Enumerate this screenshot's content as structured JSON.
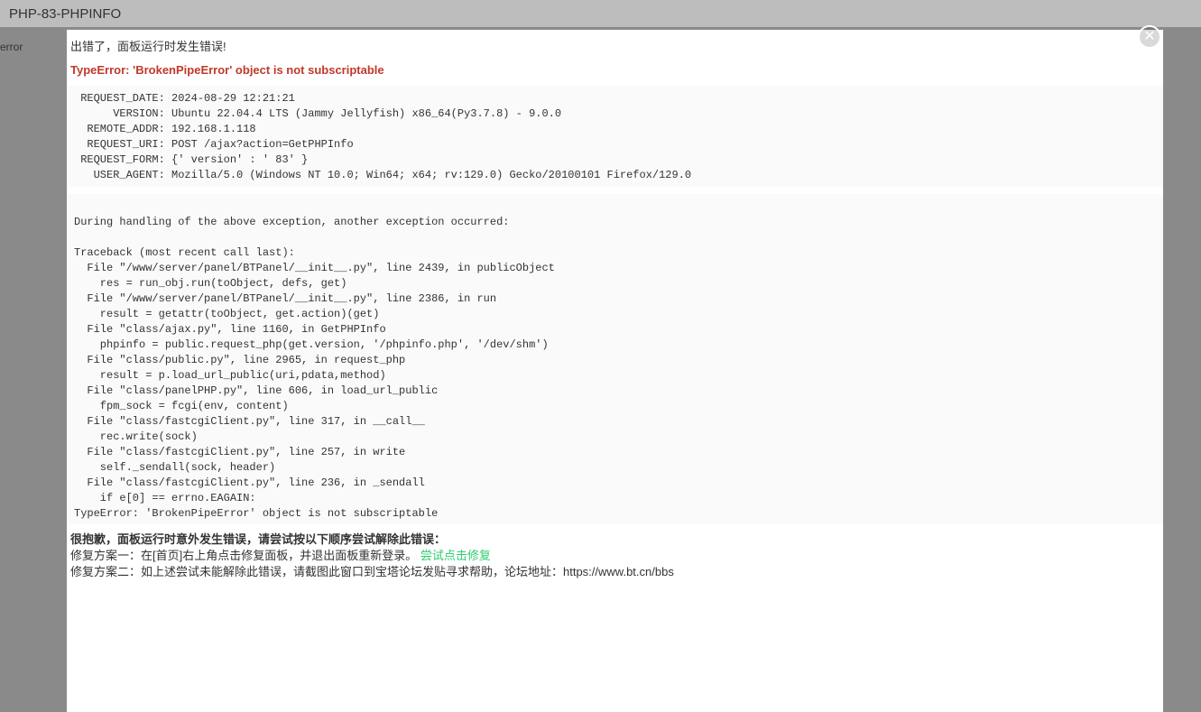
{
  "window": {
    "title": "PHP-83-PHPINFO",
    "left_label": "error"
  },
  "modal": {
    "error_heading": "出错了，面板运行时发生错误!",
    "type_error": "TypeError: 'BrokenPipeError' object is not subscriptable"
  },
  "request_block": " REQUEST_DATE: 2024-08-29 12:21:21\n      VERSION: Ubuntu 22.04.4 LTS (Jammy Jellyfish) x86_64(Py3.7.8) - 9.0.0\n  REMOTE_ADDR: 192.168.1.118\n  REQUEST_URI: POST /ajax?action=GetPHPInfo\n REQUEST_FORM: {' version' : ' 83' }\n   USER_AGENT: Mozilla/5.0 (Windows NT 10.0; Win64; x64; rv:129.0) Gecko/20100101 Firefox/129.0",
  "trace_block": "\nDuring handling of the above exception, another exception occurred:\n\nTraceback (most recent call last):\n  File \"/www/server/panel/BTPanel/__init__.py\", line 2439, in publicObject\n    res = run_obj.run(toObject, defs, get)\n  File \"/www/server/panel/BTPanel/__init__.py\", line 2386, in run\n    result = getattr(toObject, get.action)(get)\n  File \"class/ajax.py\", line 1160, in GetPHPInfo\n    phpinfo = public.request_php(get.version, '/phpinfo.php', '/dev/shm')\n  File \"class/public.py\", line 2965, in request_php\n    result = p.load_url_public(uri,pdata,method)\n  File \"class/panelPHP.py\", line 606, in load_url_public\n    fpm_sock = fcgi(env, content)\n  File \"class/fastcgiClient.py\", line 317, in __call__\n    rec.write(sock)\n  File \"class/fastcgiClient.py\", line 257, in write\n    self._sendall(sock, header)\n  File \"class/fastcgiClient.py\", line 236, in _sendall\n    if e[0] == errno.EAGAIN:\nTypeError: 'BrokenPipeError' object is not subscriptable",
  "footer": {
    "apology": "很抱歉，面板运行时意外发生错误，请尝试按以下顺序尝试解除此错误：",
    "plan1_prefix": "修复方案一：在[首页]右上角点击修复面板，并退出面板重新登录。",
    "repair_link": "尝试点击修复",
    "plan2": "修复方案二：如上述尝试未能解除此错误，请截图此窗口到宝塔论坛发贴寻求帮助，论坛地址：https://www.bt.cn/bbs"
  }
}
